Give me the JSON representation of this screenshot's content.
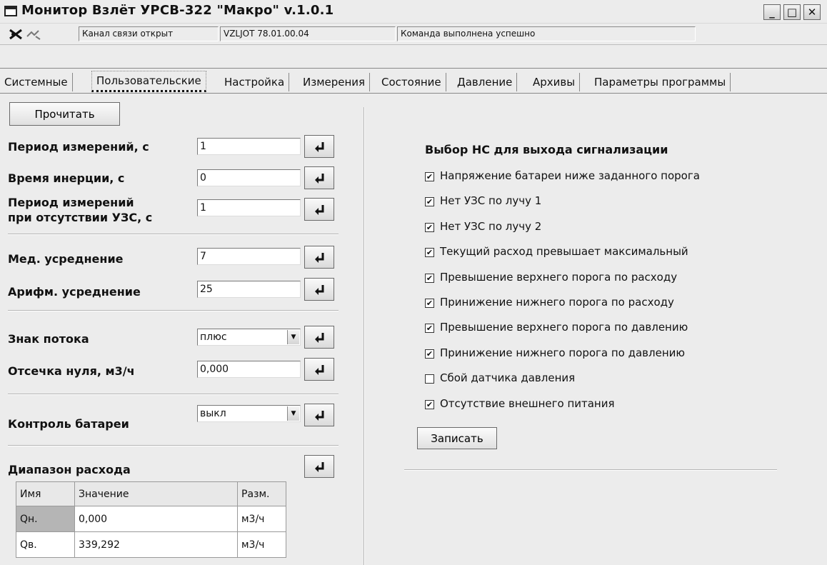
{
  "window": {
    "title": "Монитор Взлёт УРСВ-322 \"Макро\" v.1.0.1"
  },
  "status": {
    "channel": "Канал связи открыт",
    "device": "VZLJOT 78.01.00.04",
    "message": "Команда выполнена успешно"
  },
  "tabs": [
    "Системные",
    "Пользовательские",
    "Настройка",
    "Измерения",
    "Состояние",
    "Давление",
    "Архивы",
    "Параметры программы"
  ],
  "left": {
    "read_button": "Прочитать",
    "fields": [
      {
        "label": "Период измерений, с",
        "value": "1"
      },
      {
        "label": "Время инерции, с",
        "value": "0"
      },
      {
        "label": "Период измерений",
        "label2": "при отсутствии УЗС, с",
        "value": "1"
      },
      {
        "label": "Мед. усреднение",
        "value": "7"
      },
      {
        "label": "Арифм. усреднение",
        "value": "25"
      },
      {
        "label": "Знак потока",
        "value": "плюс"
      },
      {
        "label": "Отсечка нуля, м3/ч",
        "value": "0,000"
      },
      {
        "label": "Контроль батареи",
        "value": "выкл"
      }
    ],
    "range": {
      "title": "Диапазон расхода",
      "headers": [
        "Имя",
        "Значение",
        "Разм."
      ],
      "rows": [
        {
          "name": "Qн.",
          "value": "0,000",
          "unit": "м3/ч"
        },
        {
          "name": "Qв.",
          "value": "339,292",
          "unit": "м3/ч"
        }
      ]
    }
  },
  "right": {
    "title": "Выбор НС для выхода сигнализации",
    "items": [
      {
        "label": "Напряжение батареи ниже заданного порога",
        "checked": true
      },
      {
        "label": "Нет УЗС по лучу 1",
        "checked": true
      },
      {
        "label": "Нет УЗС по лучу 2",
        "checked": true
      },
      {
        "label": "Текущий расход превышает максимальный",
        "checked": true
      },
      {
        "label": "Превышение верхнего порога по расходу",
        "checked": true
      },
      {
        "label": "Принижение нижнего порога по расходу",
        "checked": true
      },
      {
        "label": "Превышение верхнего порога по давлению",
        "checked": true
      },
      {
        "label": "Принижение нижнего порога по давлению",
        "checked": true
      },
      {
        "label": "Сбой датчика давления",
        "checked": false
      },
      {
        "label": "Отсутствие внешнего питания",
        "checked": true
      }
    ],
    "write_button": "Записать"
  }
}
